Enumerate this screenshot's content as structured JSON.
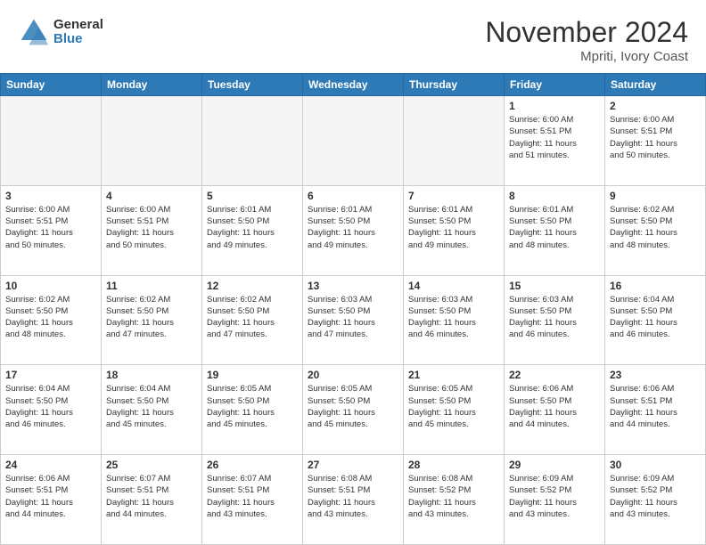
{
  "header": {
    "logo_general": "General",
    "logo_blue": "Blue",
    "month_title": "November 2024",
    "location": "Mpriti, Ivory Coast"
  },
  "days_of_week": [
    "Sunday",
    "Monday",
    "Tuesday",
    "Wednesday",
    "Thursday",
    "Friday",
    "Saturday"
  ],
  "weeks": [
    [
      {
        "day": "",
        "info": "",
        "empty": true
      },
      {
        "day": "",
        "info": "",
        "empty": true
      },
      {
        "day": "",
        "info": "",
        "empty": true
      },
      {
        "day": "",
        "info": "",
        "empty": true
      },
      {
        "day": "",
        "info": "",
        "empty": true
      },
      {
        "day": "1",
        "info": "Sunrise: 6:00 AM\nSunset: 5:51 PM\nDaylight: 11 hours\nand 51 minutes."
      },
      {
        "day": "2",
        "info": "Sunrise: 6:00 AM\nSunset: 5:51 PM\nDaylight: 11 hours\nand 50 minutes."
      }
    ],
    [
      {
        "day": "3",
        "info": "Sunrise: 6:00 AM\nSunset: 5:51 PM\nDaylight: 11 hours\nand 50 minutes."
      },
      {
        "day": "4",
        "info": "Sunrise: 6:00 AM\nSunset: 5:51 PM\nDaylight: 11 hours\nand 50 minutes."
      },
      {
        "day": "5",
        "info": "Sunrise: 6:01 AM\nSunset: 5:50 PM\nDaylight: 11 hours\nand 49 minutes."
      },
      {
        "day": "6",
        "info": "Sunrise: 6:01 AM\nSunset: 5:50 PM\nDaylight: 11 hours\nand 49 minutes."
      },
      {
        "day": "7",
        "info": "Sunrise: 6:01 AM\nSunset: 5:50 PM\nDaylight: 11 hours\nand 49 minutes."
      },
      {
        "day": "8",
        "info": "Sunrise: 6:01 AM\nSunset: 5:50 PM\nDaylight: 11 hours\nand 48 minutes."
      },
      {
        "day": "9",
        "info": "Sunrise: 6:02 AM\nSunset: 5:50 PM\nDaylight: 11 hours\nand 48 minutes."
      }
    ],
    [
      {
        "day": "10",
        "info": "Sunrise: 6:02 AM\nSunset: 5:50 PM\nDaylight: 11 hours\nand 48 minutes."
      },
      {
        "day": "11",
        "info": "Sunrise: 6:02 AM\nSunset: 5:50 PM\nDaylight: 11 hours\nand 47 minutes."
      },
      {
        "day": "12",
        "info": "Sunrise: 6:02 AM\nSunset: 5:50 PM\nDaylight: 11 hours\nand 47 minutes."
      },
      {
        "day": "13",
        "info": "Sunrise: 6:03 AM\nSunset: 5:50 PM\nDaylight: 11 hours\nand 47 minutes."
      },
      {
        "day": "14",
        "info": "Sunrise: 6:03 AM\nSunset: 5:50 PM\nDaylight: 11 hours\nand 46 minutes."
      },
      {
        "day": "15",
        "info": "Sunrise: 6:03 AM\nSunset: 5:50 PM\nDaylight: 11 hours\nand 46 minutes."
      },
      {
        "day": "16",
        "info": "Sunrise: 6:04 AM\nSunset: 5:50 PM\nDaylight: 11 hours\nand 46 minutes."
      }
    ],
    [
      {
        "day": "17",
        "info": "Sunrise: 6:04 AM\nSunset: 5:50 PM\nDaylight: 11 hours\nand 46 minutes."
      },
      {
        "day": "18",
        "info": "Sunrise: 6:04 AM\nSunset: 5:50 PM\nDaylight: 11 hours\nand 45 minutes."
      },
      {
        "day": "19",
        "info": "Sunrise: 6:05 AM\nSunset: 5:50 PM\nDaylight: 11 hours\nand 45 minutes."
      },
      {
        "day": "20",
        "info": "Sunrise: 6:05 AM\nSunset: 5:50 PM\nDaylight: 11 hours\nand 45 minutes."
      },
      {
        "day": "21",
        "info": "Sunrise: 6:05 AM\nSunset: 5:50 PM\nDaylight: 11 hours\nand 45 minutes."
      },
      {
        "day": "22",
        "info": "Sunrise: 6:06 AM\nSunset: 5:50 PM\nDaylight: 11 hours\nand 44 minutes."
      },
      {
        "day": "23",
        "info": "Sunrise: 6:06 AM\nSunset: 5:51 PM\nDaylight: 11 hours\nand 44 minutes."
      }
    ],
    [
      {
        "day": "24",
        "info": "Sunrise: 6:06 AM\nSunset: 5:51 PM\nDaylight: 11 hours\nand 44 minutes."
      },
      {
        "day": "25",
        "info": "Sunrise: 6:07 AM\nSunset: 5:51 PM\nDaylight: 11 hours\nand 44 minutes."
      },
      {
        "day": "26",
        "info": "Sunrise: 6:07 AM\nSunset: 5:51 PM\nDaylight: 11 hours\nand 43 minutes."
      },
      {
        "day": "27",
        "info": "Sunrise: 6:08 AM\nSunset: 5:51 PM\nDaylight: 11 hours\nand 43 minutes."
      },
      {
        "day": "28",
        "info": "Sunrise: 6:08 AM\nSunset: 5:52 PM\nDaylight: 11 hours\nand 43 minutes."
      },
      {
        "day": "29",
        "info": "Sunrise: 6:09 AM\nSunset: 5:52 PM\nDaylight: 11 hours\nand 43 minutes."
      },
      {
        "day": "30",
        "info": "Sunrise: 6:09 AM\nSunset: 5:52 PM\nDaylight: 11 hours\nand 43 minutes."
      }
    ]
  ]
}
